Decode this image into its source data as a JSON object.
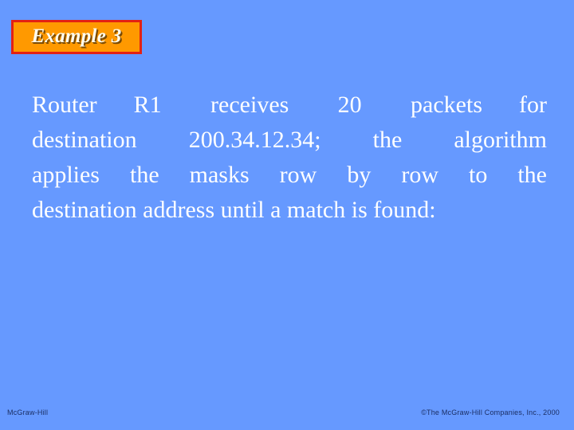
{
  "slide": {
    "background_color": "#6699FF",
    "title": {
      "label": "Example 3",
      "fill_color": "#FF9900",
      "border_color": "#E32113",
      "text_color": "#FFFDF0"
    },
    "body": {
      "text_color": "#FFFFFF",
      "lines": [
        "Router   R1    receives    20    packets   for",
        "destination   200.34.12.34;   the   algorithm",
        "applies  the  masks  row  by  row  to  the",
        "destination address until a match is found:"
      ],
      "full_text": "Router R1 receives 20 packets for destination 200.34.12.34; the algorithm applies the masks row by row to the destination address until a match is found:"
    },
    "footer": {
      "left_label": "McGraw-Hill",
      "right_label": "©The McGraw-Hill Companies, Inc., 2000",
      "text_color": "#1B2E63"
    }
  }
}
